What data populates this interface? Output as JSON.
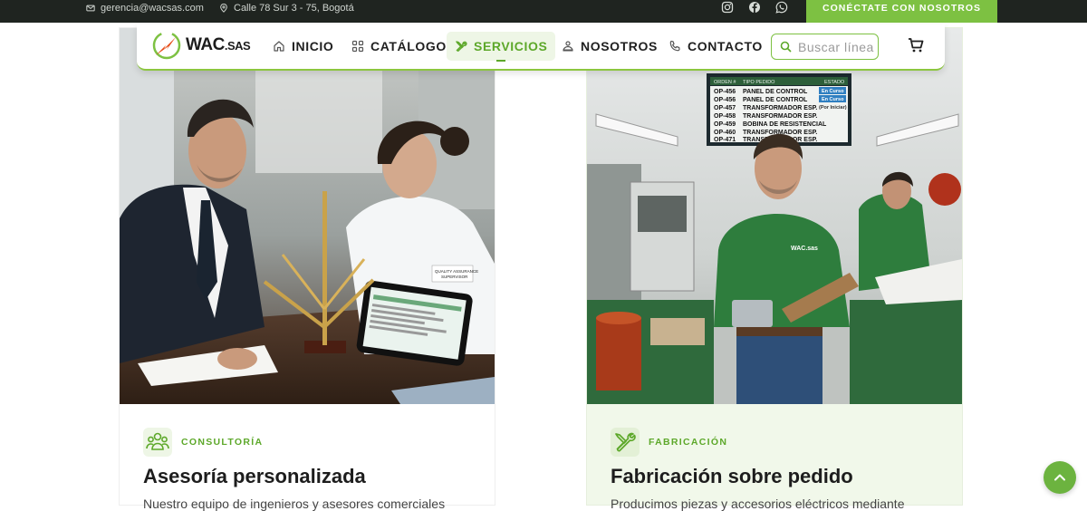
{
  "topbar": {
    "email": "gerencia@wacsas.com",
    "address": "Calle 78 Sur 3 - 75, Bogotá",
    "social": [
      "instagram-icon",
      "facebook-icon",
      "whatsapp-icon"
    ],
    "cta_label": "CONÉCTATE CON NOSOTROS"
  },
  "navbar": {
    "logo_main": "WAC",
    "logo_suffix": ".SAS",
    "items": [
      {
        "label": "INICIO",
        "icon": "home-icon"
      },
      {
        "label": "CATÁLOGO",
        "icon": "grid-icon"
      },
      {
        "label": "SERVICIOS",
        "icon": "tools-icon",
        "active": true
      },
      {
        "label": "NOSOTROS",
        "icon": "team-icon"
      },
      {
        "label": "CONTACTO",
        "icon": "phone-icon"
      }
    ],
    "search_placeholder": "Buscar línea",
    "cart_icon": "cart-icon"
  },
  "cards": [
    {
      "category": "CONSULTORÍA",
      "title": "Asesoría personalizada",
      "description": "Nuestro equipo de ingenieros y asesores comerciales",
      "icon": "people-icon"
    },
    {
      "category": "FABRICACIÓN",
      "title": "Fabricación sobre pedido",
      "description": "Producimos piezas y accesorios eléctricos mediante",
      "icon": "wrench-screwdriver-icon"
    }
  ],
  "photo_left": {
    "badge": "QUALITY ASSURANCE SUPERVISOR"
  },
  "photo_right": {
    "board_headers": [
      "ORDEN #",
      "TIPO PEDIDO",
      "ESTADO"
    ],
    "board_rows": [
      [
        "OP-456",
        "PANEL DE CONTROL",
        "En Curso"
      ],
      [
        "OP-456",
        "PANEL DE CONTROL",
        "En Curso"
      ],
      [
        "OP-457",
        "TRANSFORMADOR ESP.",
        "(Por Iniciar)"
      ],
      [
        "OP-458",
        "TRANSFORMADOR ESP.",
        ""
      ],
      [
        "OP-459",
        "BOBINA DE RESISTENCIAL",
        ""
      ],
      [
        "OP-460",
        "TRANSFORMADOR ESP.",
        ""
      ],
      [
        "OP-471",
        "TRANSFORMADOR ESP.",
        ""
      ]
    ],
    "shirt_logo": "WAC.sas"
  },
  "colors": {
    "brand_green": "#7dc142",
    "accent_green": "#5da82a",
    "topbar_bg": "#1f2420"
  }
}
